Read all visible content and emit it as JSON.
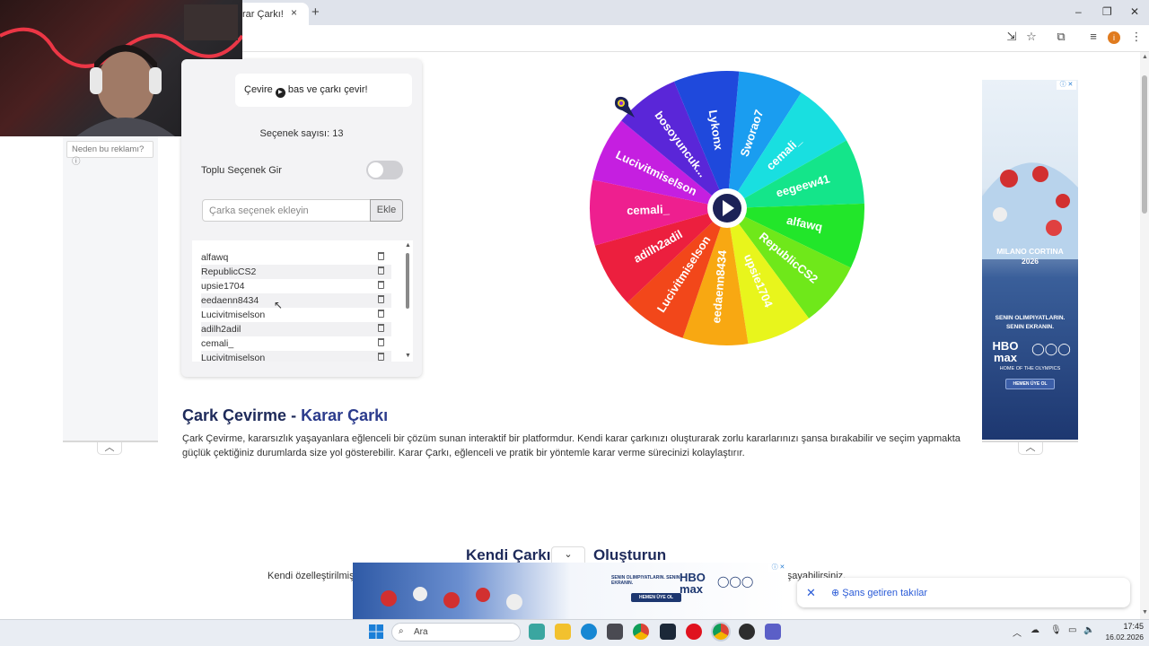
{
  "browser": {
    "tab_title": "rar Çarkı!",
    "tab_close": "×",
    "new_tab": "+",
    "window_minimize": "–",
    "window_restore": "❐",
    "window_close": "✕"
  },
  "left_ad": {
    "why_ad_label": "Neden bu reklamı? ⓘ",
    "collapse_glyph": "︿"
  },
  "panel": {
    "hint_prefix": "Çevire",
    "hint_suffix": "bas ve çarkı çevir!",
    "option_count_label": "Seçenek sayısı: 13",
    "bulk_toggle_label": "Toplu Seçenek Gir",
    "bulk_toggle_on": false,
    "input_placeholder": "Çarka seçenek ekleyin",
    "add_button_label": "Ekle",
    "options": [
      "alfawq",
      "RepublicCS2",
      "upsie1704",
      "eedaenn8434",
      "Lucivitmiselson",
      "adilh2adil",
      "cemali_",
      "Lucivitmiselson"
    ]
  },
  "wheel": {
    "segments": [
      {
        "label": "Sworao7",
        "color": "#1a9df0"
      },
      {
        "label": "cemali_",
        "color": "#19dfe0"
      },
      {
        "label": "eegeew41",
        "color": "#14e58a"
      },
      {
        "label": "alfawq",
        "color": "#22e62a"
      },
      {
        "label": "RepublicCS2",
        "color": "#6fe81a"
      },
      {
        "label": "upsie1704",
        "color": "#e8f51c"
      },
      {
        "label": "eedaenn8434",
        "color": "#f8a812"
      },
      {
        "label": "Lucivitmiselson",
        "color": "#f2471a"
      },
      {
        "label": "adilh2adil",
        "color": "#ec1f3e"
      },
      {
        "label": "cemali_",
        "color": "#ee1f8f"
      },
      {
        "label": "Lucivitmiselson",
        "color": "#c51fe0"
      },
      {
        "label": "bosoyuncuk...",
        "color": "#5a26d8"
      },
      {
        "label": "Lykonx",
        "color": "#1f49dc"
      }
    ]
  },
  "right_ad": {
    "brand_line": "MILANO CORTINA",
    "brand_year": "2026",
    "headline_1": "SENIN OLIMPIYATLARIN.",
    "headline_2": "SENIN EKRANIN.",
    "streamer": "HBO max",
    "tagline": "HOME OF THE OLYMPICS",
    "cta": "HEMEN ÜYE OL",
    "collapse_glyph": "︿"
  },
  "content": {
    "title_main": "Çark Çevirme - ",
    "title_accent": "Karar Çarkı",
    "body": "Çark Çevirme, kararsızlık yaşayanlara eğlenceli bir çözüm sunan interaktif bir platformdur. Kendi karar çarkınızı oluşturarak zorlu kararlarınızı şansa bırakabilir ve seçim yapmakta güçlük çektiğiniz durumlarda size yol gösterebilir. Karar Çarkı, eğlenceli ve pratik bir yöntemle karar verme sürecinizi kolaylaştırır.",
    "section2_title_left": "Kendi Çarkı",
    "section2_title_right": "Oluşturun",
    "section2_body_left": "Kendi özelleştirilmiş",
    "section2_body_right": "n yaşayabilirsiniz."
  },
  "bottom_ad": {
    "collapse_glyph": "⌄",
    "headline": "SENIN OLIMPIYATLARIN. SENIN EKRANIN.",
    "streamer": "HBO max",
    "cta": "HEMEN ÜYE OL"
  },
  "toast": {
    "close_glyph": "✕",
    "label": "⊕ Şans getiren takılar"
  },
  "taskbar": {
    "search_placeholder": "Ara",
    "time": "17:45",
    "date": "16.02.2026"
  }
}
